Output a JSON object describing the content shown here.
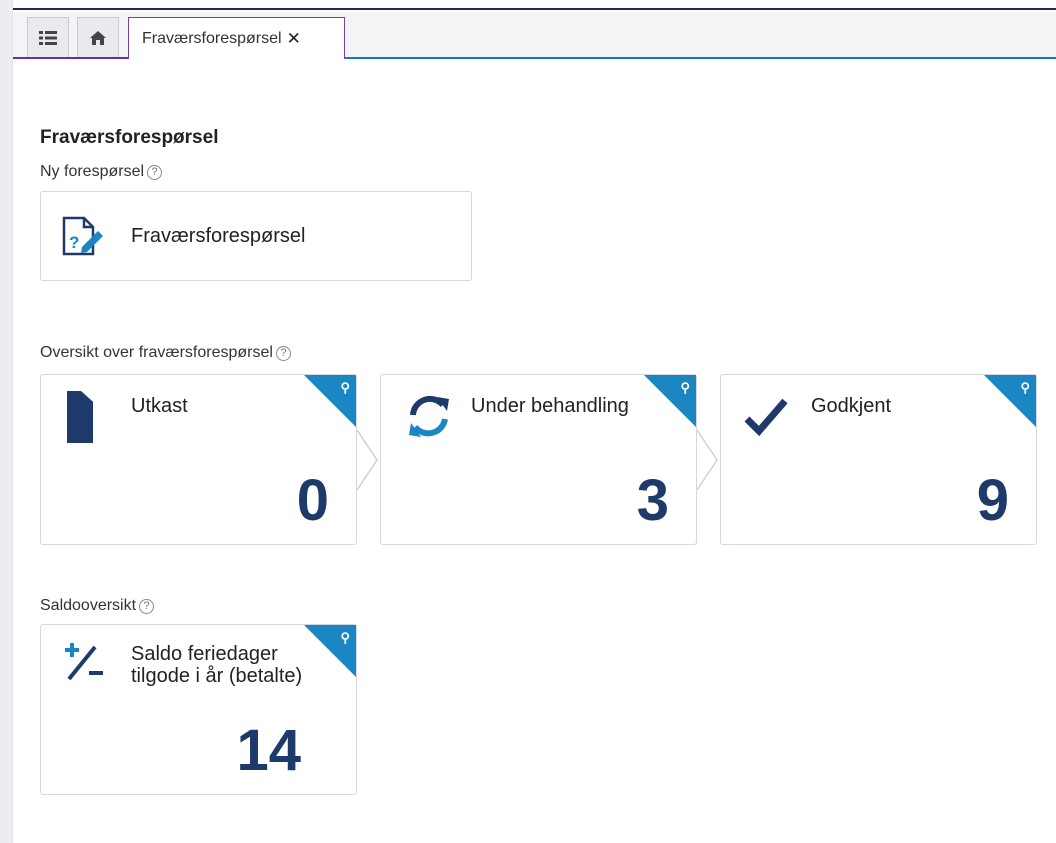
{
  "tabs": {
    "active_label": "Fraværsforespørsel",
    "close_glyph": "✕"
  },
  "page": {
    "title": "Fraværsforespørsel",
    "new_request_label": "Ny forespørsel",
    "new_request_card": "Fraværsforespørsel",
    "overview_label": "Oversikt over fraværsforespørsel",
    "balance_label": "Saldooversikt"
  },
  "status_tiles": [
    {
      "label": "Utkast",
      "value": "0",
      "icon": "document-icon"
    },
    {
      "label": "Under behandling",
      "value": "3",
      "icon": "refresh-icon"
    },
    {
      "label": "Godkjent",
      "value": "9",
      "icon": "checkmark-icon"
    }
  ],
  "balance_tile": {
    "label": "Saldo feriedager tilgode i år (betalte)",
    "value": "14",
    "icon": "plus-minus-icon"
  },
  "colors": {
    "accent_blue": "#1b86c4",
    "value_navy": "#1e3a6b",
    "tab_active_border": "#7b3fa8"
  },
  "help_glyph": "?"
}
